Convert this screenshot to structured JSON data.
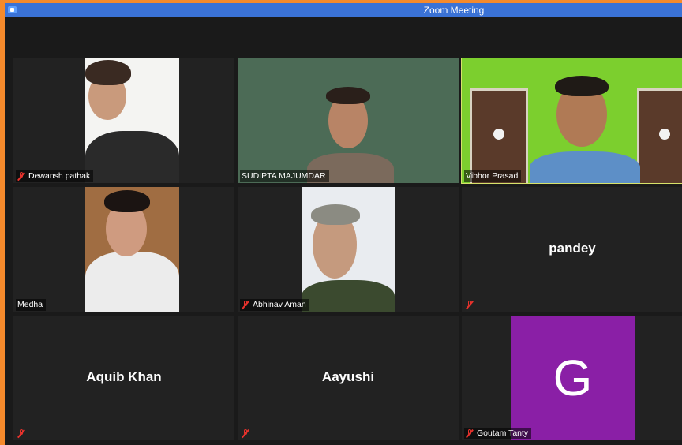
{
  "window": {
    "title": "Zoom Meeting"
  },
  "participants": [
    {
      "name": "Dewansh pathak",
      "muted": true,
      "video": true
    },
    {
      "name": "SUDIPTA MAJUMDAR",
      "muted": false,
      "video": true
    },
    {
      "name": "Vibhor Prasad",
      "muted": false,
      "video": true,
      "active_speaker": true
    },
    {
      "name": "Medha",
      "muted": false,
      "video": true
    },
    {
      "name": "Abhinav Aman",
      "muted": true,
      "video": true
    },
    {
      "name": "pandey",
      "muted": true,
      "video": false
    },
    {
      "name": "Aquib Khan",
      "muted": true,
      "video": false
    },
    {
      "name": "Aayushi",
      "muted": true,
      "video": false
    },
    {
      "name": "Goutam Tanty",
      "muted": true,
      "video": false,
      "avatar_letter": "G",
      "avatar_color": "#8a1fa6"
    }
  ],
  "colors": {
    "frame": "#f58a2c",
    "titlebar": "#3a72d6",
    "background": "#1a1a1a",
    "active_speaker_border": "#d7e26a",
    "mute_icon": "#e8322c"
  },
  "icons": {
    "app": "zoom-app-icon",
    "mute": "microphone-muted-icon"
  }
}
